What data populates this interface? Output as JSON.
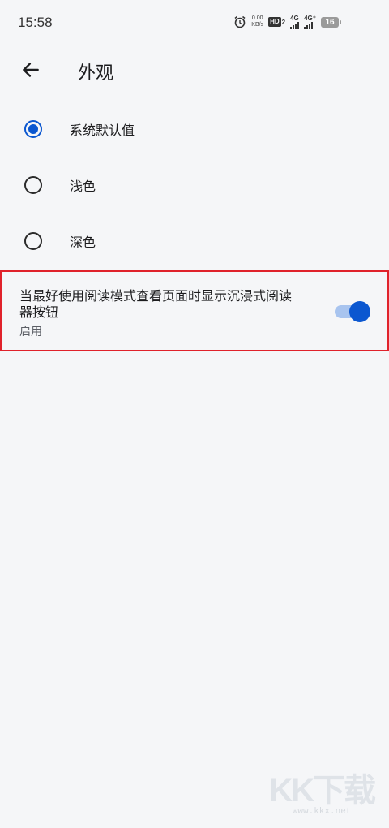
{
  "status_bar": {
    "time": "15:58",
    "net_speed_value": "0.00",
    "net_speed_unit": "KB/s",
    "hd_label": "HD",
    "hd_sub": "2",
    "signal1_label": "4G",
    "signal2_label": "4G⁺",
    "battery_level": "16"
  },
  "app_bar": {
    "title": "外观"
  },
  "theme_options": [
    {
      "label": "系统默认值",
      "selected": true
    },
    {
      "label": "浅色",
      "selected": false
    },
    {
      "label": "深色",
      "selected": false
    }
  ],
  "reader_mode": {
    "title": "当最好使用阅读模式查看页面时显示沉浸式阅读器按钮",
    "status": "启用",
    "enabled": true
  },
  "colors": {
    "accent": "#0b57d0",
    "track": "#a8c4ef",
    "highlight_border": "#e0222b",
    "background": "#f5f6f8"
  },
  "watermark": {
    "logo": "KK下载",
    "url": "www.kkx.net"
  }
}
